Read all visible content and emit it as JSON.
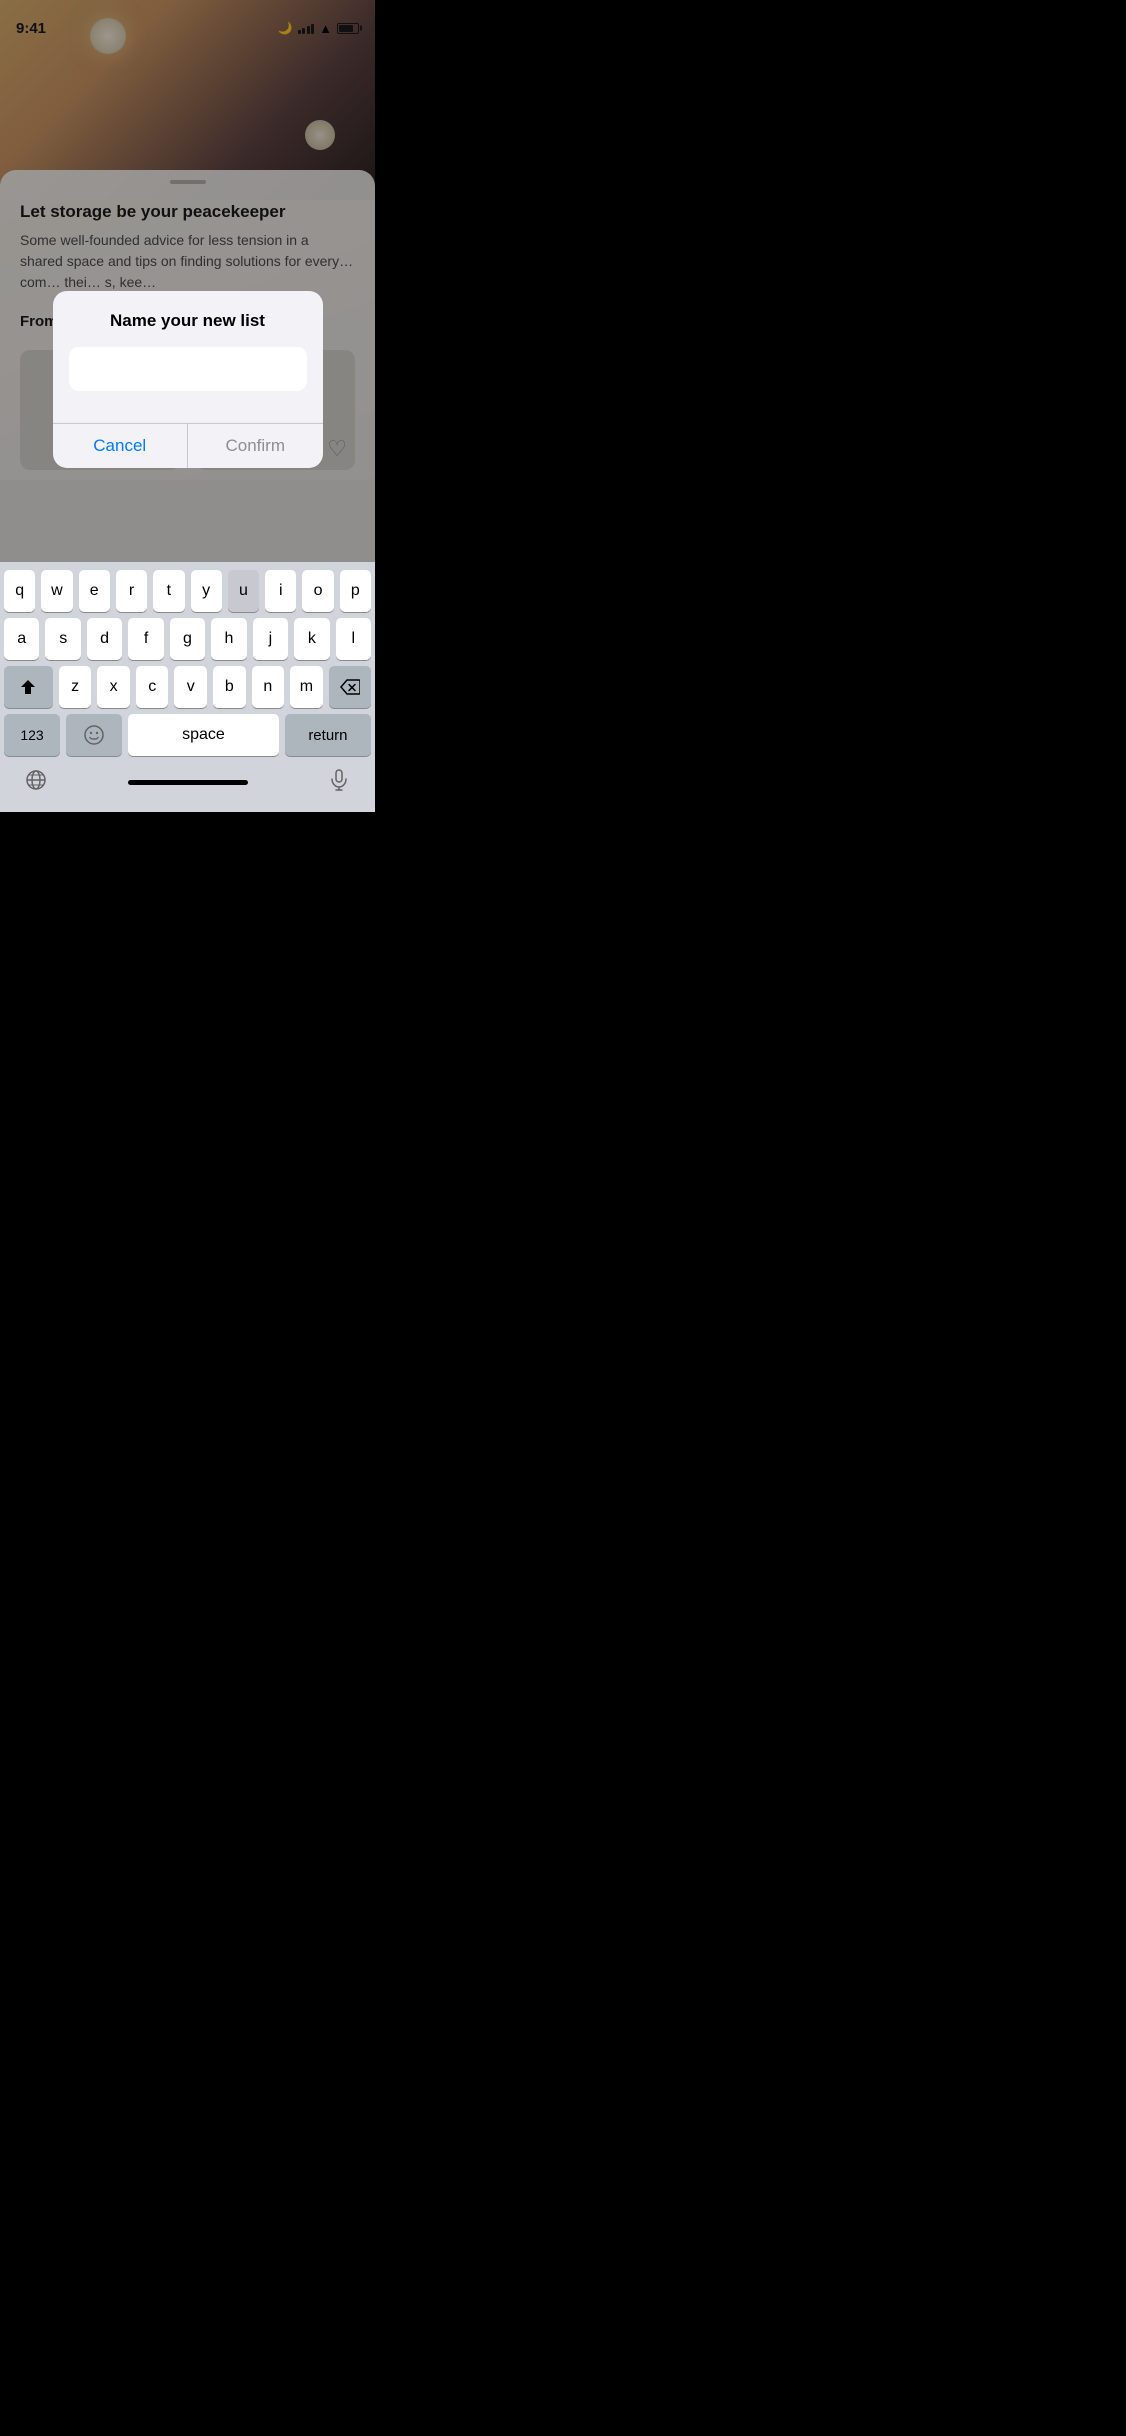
{
  "statusBar": {
    "time": "9:41",
    "moonIcon": "🌙"
  },
  "background": {
    "articleTitle": "Let storage be your peacekeeper",
    "articleBody": "Some well-founded advice for less tension in a shared space and tips on finding solutions for everyone's items so they can find their com… and their belongings. Keeping thei… s, kee…",
    "sectionTitle": "From this space"
  },
  "modal": {
    "title": "Name your new list",
    "inputPlaceholder": "",
    "cancelLabel": "Cancel",
    "confirmLabel": "Confirm"
  },
  "keyboard": {
    "rows": [
      [
        "q",
        "w",
        "e",
        "r",
        "t",
        "y",
        "u",
        "i",
        "o",
        "p"
      ],
      [
        "a",
        "s",
        "d",
        "f",
        "g",
        "h",
        "j",
        "k",
        "l"
      ],
      [
        "z",
        "x",
        "c",
        "v",
        "b",
        "n",
        "m"
      ]
    ],
    "spaceLabel": "space",
    "returnLabel": "return",
    "numbersLabel": "123",
    "highlightedKey": "u"
  }
}
